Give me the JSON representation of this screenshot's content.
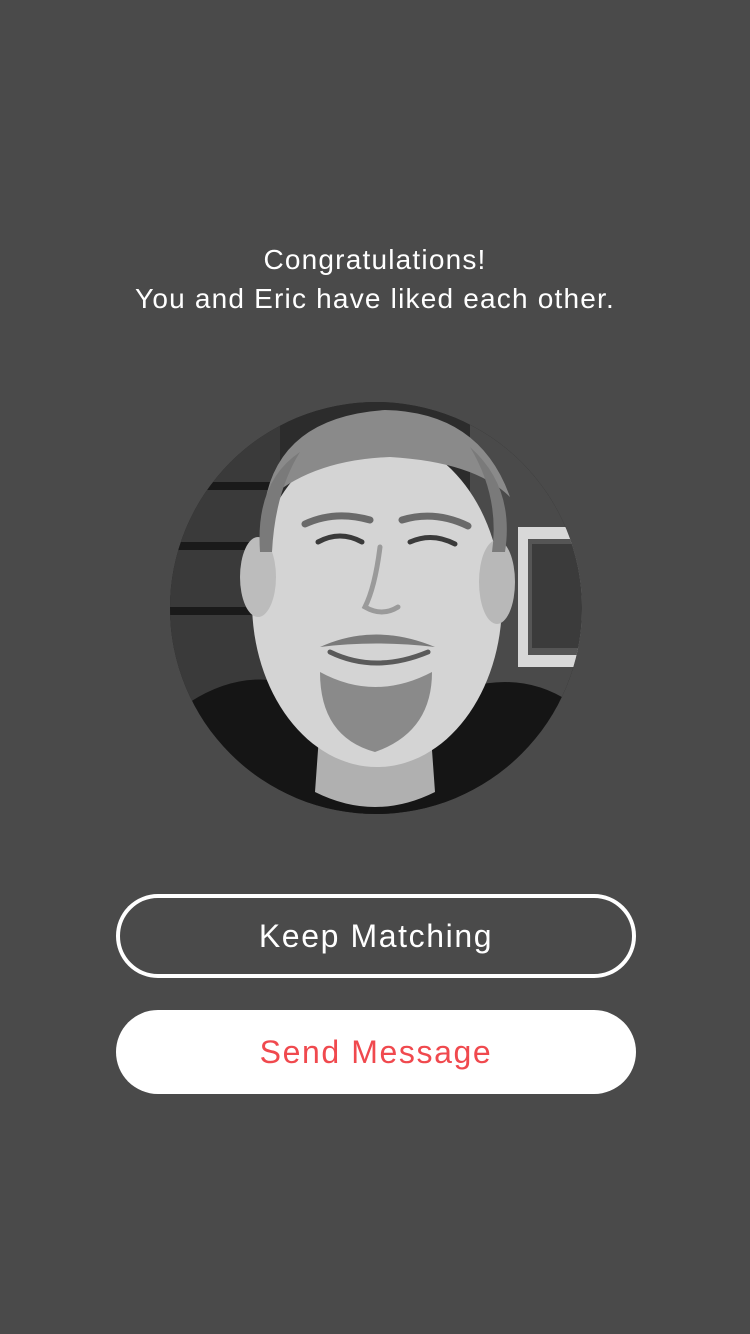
{
  "match": {
    "headline": "Congratulations!",
    "subline": "You and Eric have liked each other.",
    "avatar_icon": "profile-photo"
  },
  "actions": {
    "keep_matching_label": "Keep Matching",
    "send_message_label": "Send Message"
  },
  "colors": {
    "background": "#4a4a4a",
    "text": "#ffffff",
    "accent": "#f0494e",
    "button_fill": "#ffffff"
  }
}
